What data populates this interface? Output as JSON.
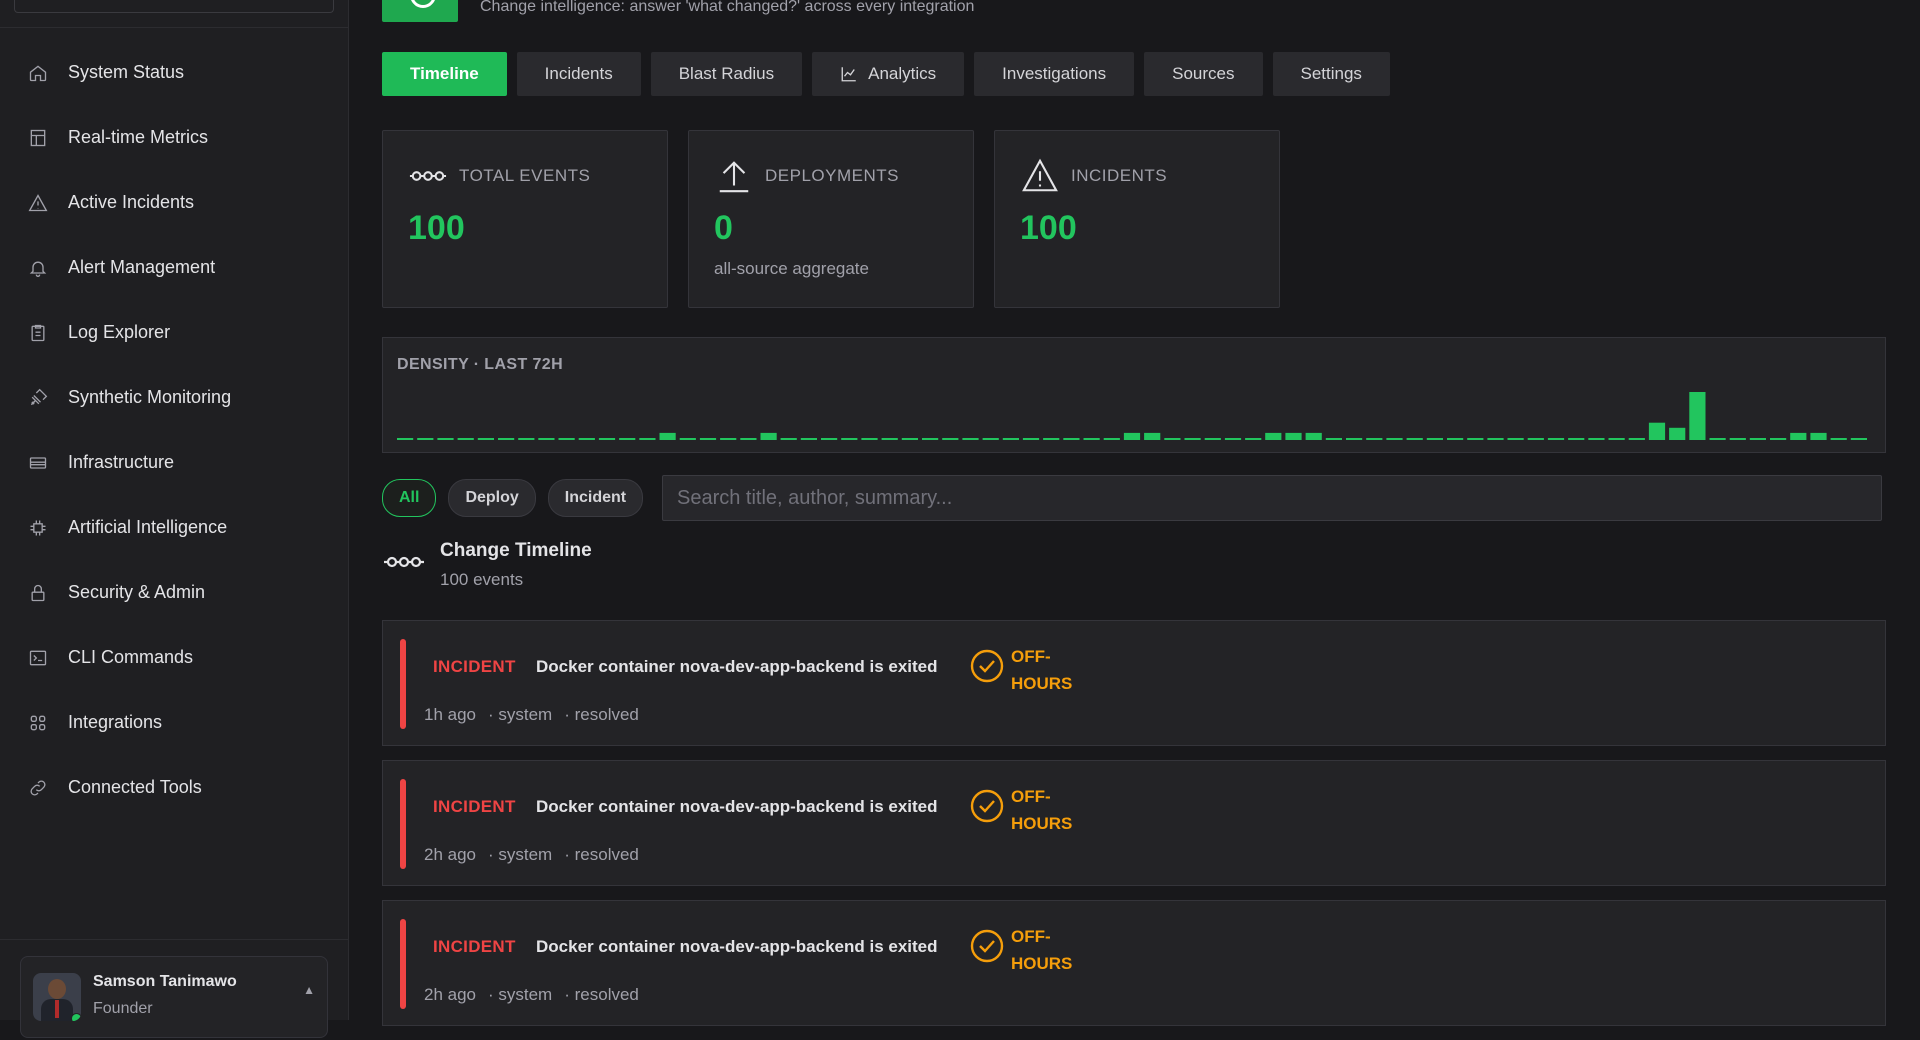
{
  "header": {
    "subtitle": "Change intelligence: answer 'what changed?' across every integration"
  },
  "sidebar": {
    "items": [
      {
        "label": "System Status",
        "icon": "home-icon"
      },
      {
        "label": "Real-time Metrics",
        "icon": "layout-icon"
      },
      {
        "label": "Active Incidents",
        "icon": "warning-icon"
      },
      {
        "label": "Alert Management",
        "icon": "bell-icon"
      },
      {
        "label": "Log Explorer",
        "icon": "clipboard-icon"
      },
      {
        "label": "Synthetic Monitoring",
        "icon": "satellite-icon"
      },
      {
        "label": "Infrastructure",
        "icon": "server-icon"
      },
      {
        "label": "Artificial Intelligence",
        "icon": "chip-icon"
      },
      {
        "label": "Security & Admin",
        "icon": "lock-icon"
      },
      {
        "label": "CLI Commands",
        "icon": "terminal-icon"
      },
      {
        "label": "Integrations",
        "icon": "grid-icon"
      },
      {
        "label": "Connected Tools",
        "icon": "link-icon"
      }
    ],
    "user": {
      "name": "Samson Tanimawo",
      "role": "Founder"
    }
  },
  "tabs": [
    {
      "label": "Timeline",
      "active": true
    },
    {
      "label": "Incidents",
      "active": false
    },
    {
      "label": "Blast Radius",
      "active": false
    },
    {
      "label": "Analytics",
      "active": false,
      "icon": "chart-line-icon"
    },
    {
      "label": "Investigations",
      "active": false
    },
    {
      "label": "Sources",
      "active": false
    },
    {
      "label": "Settings",
      "active": false
    }
  ],
  "stats": [
    {
      "label": "TOTAL EVENTS",
      "value": "100",
      "sub": "",
      "icon": "git-commit-icon"
    },
    {
      "label": "DEPLOYMENTS",
      "value": "0",
      "sub": "all-source aggregate",
      "icon": "upload-icon"
    },
    {
      "label": "INCIDENTS",
      "value": "100",
      "sub": "",
      "icon": "warning-icon"
    }
  ],
  "density": {
    "label": "DENSITY · LAST 72H"
  },
  "chart_data": {
    "type": "bar",
    "title": "DENSITY · LAST 72H",
    "categories": [],
    "values": [
      0,
      0,
      0,
      0,
      0,
      0,
      0,
      0,
      0,
      0,
      0,
      0,
      0,
      1,
      0,
      0,
      0,
      0,
      1,
      0,
      0,
      0,
      0,
      0,
      0,
      0,
      0,
      0,
      0,
      0,
      0,
      0,
      0,
      0,
      0,
      0,
      1,
      1,
      0,
      0,
      0,
      0,
      0,
      1,
      1,
      1,
      0,
      0,
      0,
      0,
      0,
      0,
      0,
      0,
      0,
      0,
      0,
      0,
      0,
      0,
      0,
      0,
      3,
      2,
      9,
      0,
      0,
      0,
      0,
      1,
      1,
      0,
      0
    ],
    "color": "#22c55e",
    "grid": false
  },
  "filters": {
    "pills": [
      {
        "label": "All",
        "active": true
      },
      {
        "label": "Deploy",
        "active": false
      },
      {
        "label": "Incident",
        "active": false
      }
    ],
    "search_placeholder": "Search title, author, summary..."
  },
  "timeline": {
    "title": "Change Timeline",
    "count": "100 events",
    "events": [
      {
        "type": "INCIDENT",
        "title": "Docker container nova-dev-app-backend is exited",
        "tag": "OFF-HOURS",
        "time": "1h ago",
        "source": "· system",
        "status": "· resolved"
      },
      {
        "type": "INCIDENT",
        "title": "Docker container nova-dev-app-backend is exited",
        "tag": "OFF-HOURS",
        "time": "2h ago",
        "source": "· system",
        "status": "· resolved"
      },
      {
        "type": "INCIDENT",
        "title": "Docker container nova-dev-app-backend is exited",
        "tag": "OFF-HOURS",
        "time": "2h ago",
        "source": "· system",
        "status": "· resolved"
      }
    ]
  },
  "colors": {
    "accent": "#22c55e",
    "incident": "#ef4444",
    "warning": "#f59e0b",
    "background": "#18181b"
  }
}
